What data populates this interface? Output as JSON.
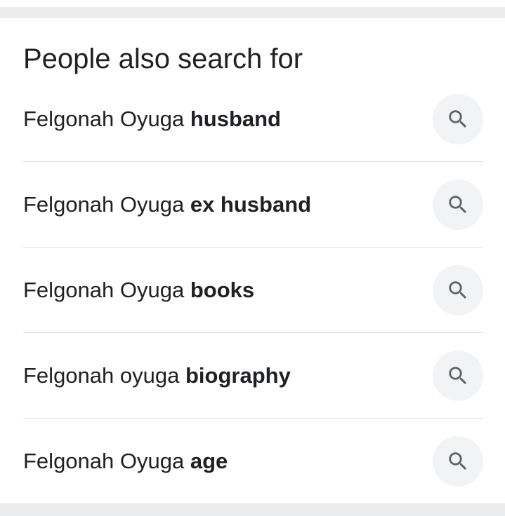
{
  "section": {
    "title": "People also search for",
    "items": [
      {
        "prefix": "Felgonah Oyuga ",
        "bold": "husband",
        "icon": "search-icon"
      },
      {
        "prefix": "Felgonah Oyuga ",
        "bold": "ex husband",
        "icon": "search-icon"
      },
      {
        "prefix": "Felgonah Oyuga ",
        "bold": "books",
        "icon": "search-icon"
      },
      {
        "prefix": "Felgonah oyuga ",
        "bold": "biography",
        "icon": "search-icon"
      },
      {
        "prefix": "Felgonah Oyuga ",
        "bold": "age",
        "icon": "search-icon"
      }
    ]
  },
  "colors": {
    "text": "#202124",
    "divider": "#dadce0",
    "icon_bg": "#f1f3f4",
    "icon": "#5f6368",
    "band": "#ebecee"
  }
}
